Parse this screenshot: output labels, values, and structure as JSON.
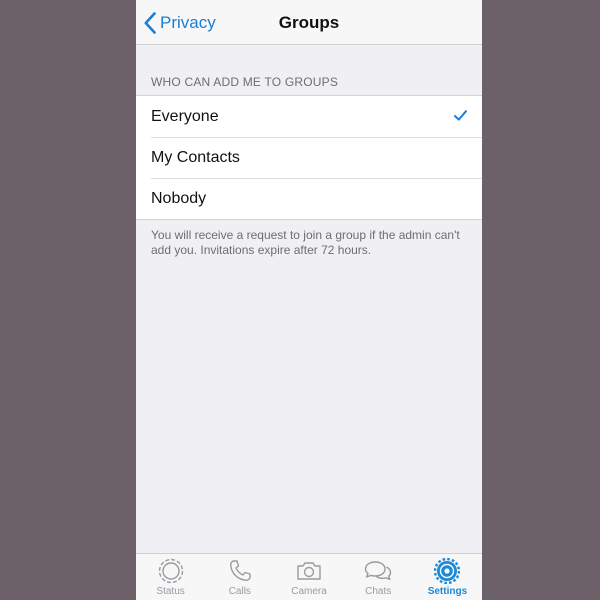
{
  "navbar": {
    "back_label": "Privacy",
    "title": "Groups"
  },
  "section": {
    "header": "WHO CAN ADD ME TO GROUPS",
    "options": [
      {
        "label": "Everyone",
        "selected": true
      },
      {
        "label": "My Contacts",
        "selected": false
      },
      {
        "label": "Nobody",
        "selected": false
      }
    ],
    "footer": "You will receive a request to join a group if the admin can't add you. Invitations expire after 72 hours."
  },
  "tabbar": {
    "tabs": [
      {
        "label": "Status",
        "icon": "status-icon",
        "active": false
      },
      {
        "label": "Calls",
        "icon": "phone-icon",
        "active": false
      },
      {
        "label": "Camera",
        "icon": "camera-icon",
        "active": false
      },
      {
        "label": "Chats",
        "icon": "chat-bubbles-icon",
        "active": false
      },
      {
        "label": "Settings",
        "icon": "gear-icon",
        "active": true
      }
    ]
  },
  "colors": {
    "accent": "#1a7fd6",
    "background": "#efeff4",
    "outer": "#6d6169"
  }
}
